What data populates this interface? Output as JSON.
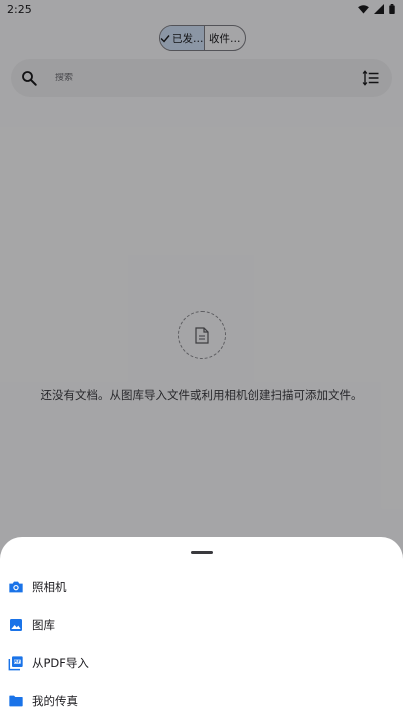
{
  "status_bar": {
    "time": "2:25",
    "icons": [
      "wifi-icon",
      "signal-icon",
      "battery-icon"
    ]
  },
  "filter": {
    "segments": [
      {
        "label": "已发…",
        "selected": true,
        "icon": "check-icon"
      },
      {
        "label": "收件…",
        "selected": false
      }
    ]
  },
  "search": {
    "placeholder": "搜索",
    "value": "",
    "icons": [
      "search-icon",
      "sort-icon"
    ]
  },
  "empty_state": {
    "icon": "document-icon",
    "message": "还没有文档。从图库导入文件或利用相机创建扫描可添加文件。"
  },
  "bottom_sheet": {
    "items": [
      {
        "label": "照相机",
        "icon": "camera-icon"
      },
      {
        "label": "图库",
        "icon": "image-icon"
      },
      {
        "label": "从PDF导入",
        "icon": "pdf-icon"
      },
      {
        "label": "我的传真",
        "icon": "folder-icon"
      }
    ]
  },
  "colors": {
    "accent": "#1a73e8",
    "segment_selected": "#cfe0f6",
    "scrim": "rgba(0,0,0,0.33)"
  }
}
